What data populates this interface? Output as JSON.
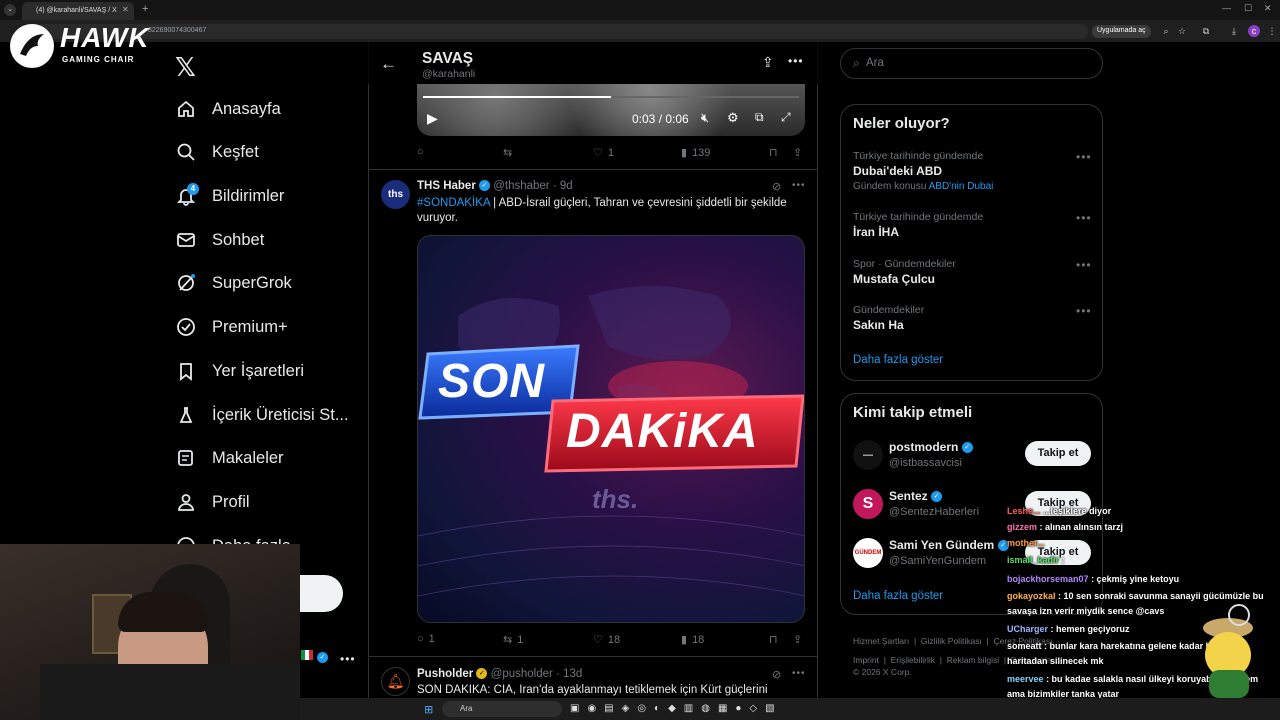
{
  "browser": {
    "tab_title": "(4) @karahanli/SAVAŞ / X",
    "url": "822690074300467",
    "open_in_app": "Uygulamada aç"
  },
  "overlay": {
    "brand": "HAWK",
    "brand_sub": "GAMING CHAIR"
  },
  "sidebar": {
    "notifications_count": "4",
    "items": [
      {
        "label": "Anasayfa",
        "icon": "home-icon"
      },
      {
        "label": "Keşfet",
        "icon": "search-icon"
      },
      {
        "label": "Bildirimler",
        "icon": "bell-icon"
      },
      {
        "label": "Sohbet",
        "icon": "mail-icon"
      },
      {
        "label": "SuperGrok",
        "icon": "grok-icon"
      },
      {
        "label": "Premium+",
        "icon": "verified-icon"
      },
      {
        "label": "Yer İşaretleri",
        "icon": "bookmark-icon"
      },
      {
        "label": "İçerik Üreticisi St...",
        "icon": "creator-studio-icon"
      },
      {
        "label": "Makaleler",
        "icon": "article-icon"
      },
      {
        "label": "Profil",
        "icon": "profile-icon"
      },
      {
        "label": "Daha fazla",
        "icon": "more-icon"
      }
    ]
  },
  "header": {
    "title": "SAVAŞ",
    "handle": "@karahanli"
  },
  "video": {
    "time": "0:03 / 0:06"
  },
  "post1_actions": {
    "replies": "",
    "reposts": "",
    "likes": "1",
    "views": "139"
  },
  "post2": {
    "name": "THS Haber",
    "handle": "@thshaber",
    "time": "9d",
    "hashtag": "#SONDAKİKA",
    "text": " | ABD-İsrail güçleri, Tahran ve çevresini şiddetli bir şekilde vuruyor.",
    "image_son": "SON",
    "image_dakika": "DAKiKA",
    "image_brand": "ths.",
    "replies": "1",
    "reposts": "1",
    "likes": "18",
    "views": "18"
  },
  "post3": {
    "name": "Pusholder",
    "handle": "@pusholder",
    "time": "13d",
    "text": "SON DAKİKA: CIA, İran'da ayaklanmayı tetiklemek için Kürt güçlerini"
  },
  "search": {
    "placeholder": "Ara"
  },
  "trends": {
    "title": "Neler oluyor?",
    "items": [
      {
        "category": "Türkiye tarihinde gündemde",
        "title": "Dubai'deki ABD",
        "sub_prefix": "Gündem konusu",
        "sub_link": "ABD'nin Dubai"
      },
      {
        "category": "Türkiye tarihinde gündemde",
        "title": "İran İHA"
      },
      {
        "category": "Spor · Gündemdekiler",
        "title": "Mustafa Çulcu"
      },
      {
        "category": "Gündemdekiler",
        "title": "Sakın Ha"
      }
    ],
    "show_more": "Daha fazla göster"
  },
  "who_to_follow": {
    "title": "Kimi takip etmeli",
    "users": [
      {
        "name": "postmodern",
        "handle": "@istbassavcisi"
      },
      {
        "name": "Sentez",
        "handle": "@SentezHaberleri"
      },
      {
        "name": "Sami Yen Gündem",
        "handle": "@SamiYenGundem"
      }
    ],
    "follow_label": "Takip et",
    "show_more": "Daha fazla göster"
  },
  "footer": {
    "links": [
      "Hizmet Şartları",
      "Gizlilik Politikası",
      "Çerez Politikası",
      "Imprint",
      "Erişilebilirlik",
      "Reklam bilgisi",
      "Daha fazla ..."
    ],
    "copyright": "© 2026 X Corp."
  },
  "chat": [
    {
      "user": "Leshe...",
      "msg": "...leşiklere diyor",
      "color": "#ff5a5a"
    },
    {
      "user": "gizzem",
      "msg": ": alınan alınsın tarzj",
      "color": "#ff6fb0"
    },
    {
      "user": "mother...",
      "msg": "",
      "color": "#ff9a3a"
    },
    {
      "user": "ismail_kadir",
      "msg": ":",
      "color": "#58e06a"
    },
    {
      "user": "bojackhorseman07",
      "msg": ": çekmiş yine ketoyu",
      "color": "#b486ff"
    },
    {
      "user": "gokayozkal",
      "msg": ": 10 sen sonraki savunma sanayii gücümüzle bu",
      "color": "#ffb347"
    },
    {
      "user": "",
      "msg": "savaşa izn verir miydik sence @cavs",
      "color": "#fff"
    },
    {
      "user": "UCharger",
      "msg": ": hemen geçiyoruz",
      "color": "#9fb4ff"
    },
    {
      "user": "someatt",
      "msg": ": bunlar kara harekatına gelene kadar haritadan",
      "color": "#ffffff"
    },
    {
      "user": "",
      "msg": "haritadan silinecek mk",
      "color": "#fff"
    },
    {
      "user": "meervee",
      "msg": ": bu kadae salakla nasıl ülkeyi koruyabiliriz dicem",
      "color": "#7fd4ff"
    },
    {
      "user": "",
      "msg": "ama bizimkiler tanka yatar",
      "color": "#fff"
    }
  ],
  "taskbar": {
    "search_placeholder": "Ara"
  }
}
